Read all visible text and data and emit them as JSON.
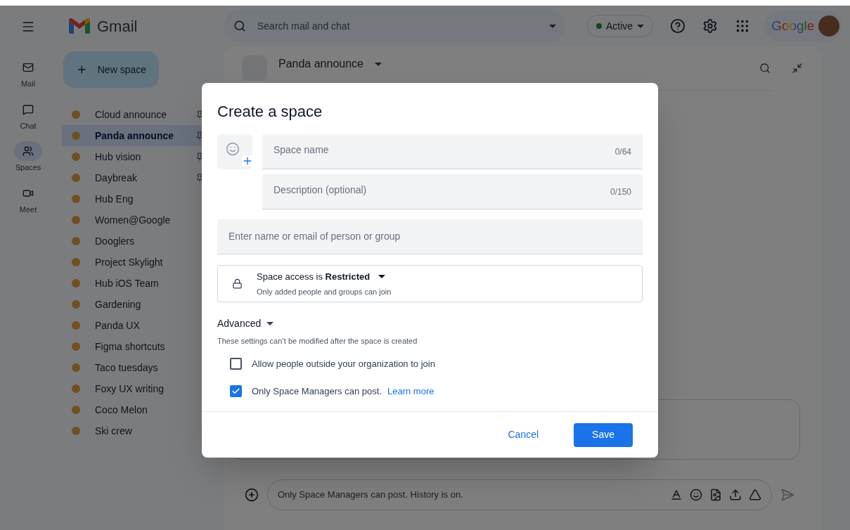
{
  "app": {
    "name": "Gmail"
  },
  "search": {
    "placeholder": "Search mail and chat"
  },
  "status": {
    "label": "Active"
  },
  "account": {
    "brand": "Google"
  },
  "rail": [
    {
      "label": "Mail",
      "kind": "mail",
      "selected": false
    },
    {
      "label": "Chat",
      "kind": "chat",
      "selected": false
    },
    {
      "label": "Spaces",
      "kind": "spaces",
      "selected": true
    },
    {
      "label": "Meet",
      "kind": "meet",
      "selected": false
    }
  ],
  "new_space": {
    "label": "New space"
  },
  "spaces": [
    {
      "name": "Cloud announce",
      "pinned": true,
      "selected": false
    },
    {
      "name": "Panda announce",
      "pinned": true,
      "selected": true
    },
    {
      "name": "Hub vision",
      "pinned": true,
      "selected": false
    },
    {
      "name": "Daybreak",
      "pinned": true,
      "selected": false
    },
    {
      "name": "Hub Eng",
      "pinned": false,
      "selected": false
    },
    {
      "name": "Women@Google",
      "pinned": false,
      "selected": false
    },
    {
      "name": "Dooglers",
      "pinned": false,
      "selected": false
    },
    {
      "name": "Project Skylight",
      "pinned": false,
      "selected": false
    },
    {
      "name": "Hub iOS Team",
      "pinned": false,
      "selected": false
    },
    {
      "name": "Gardening",
      "pinned": false,
      "selected": false
    },
    {
      "name": "Panda UX",
      "pinned": false,
      "selected": false
    },
    {
      "name": "Figma shortcuts",
      "pinned": false,
      "selected": false
    },
    {
      "name": "Taco tuesdays",
      "pinned": false,
      "selected": false
    },
    {
      "name": "Foxy UX writing",
      "pinned": false,
      "selected": false
    },
    {
      "name": "Coco Melon",
      "pinned": false,
      "selected": false
    },
    {
      "name": "Ski crew",
      "pinned": false,
      "selected": false
    }
  ],
  "conversation": {
    "title": "Panda announce",
    "composer_placeholder": "Only Space Managers can post. History is on."
  },
  "dialog": {
    "title": "Create a space",
    "name_field": {
      "placeholder": "Space name",
      "counter": "0/64"
    },
    "description_field": {
      "placeholder": "Description (optional)",
      "counter": "0/150"
    },
    "people_field": {
      "placeholder": "Enter name or email of person or group"
    },
    "access": {
      "label": "Space access is **Restricted**",
      "hint": "Only added people and groups can join"
    },
    "advanced": {
      "label": "Advanced",
      "note": "These settings can’t be modified after the space is created"
    },
    "options": [
      {
        "label": "Allow people outside your organization to join",
        "checked": false
      },
      {
        "label": "Only Space Managers can post.",
        "link": "Learn more",
        "checked": true
      }
    ],
    "buttons": [
      {
        "label": "Cancel",
        "kind": "text"
      },
      {
        "label": "Save",
        "kind": "primary"
      }
    ]
  }
}
